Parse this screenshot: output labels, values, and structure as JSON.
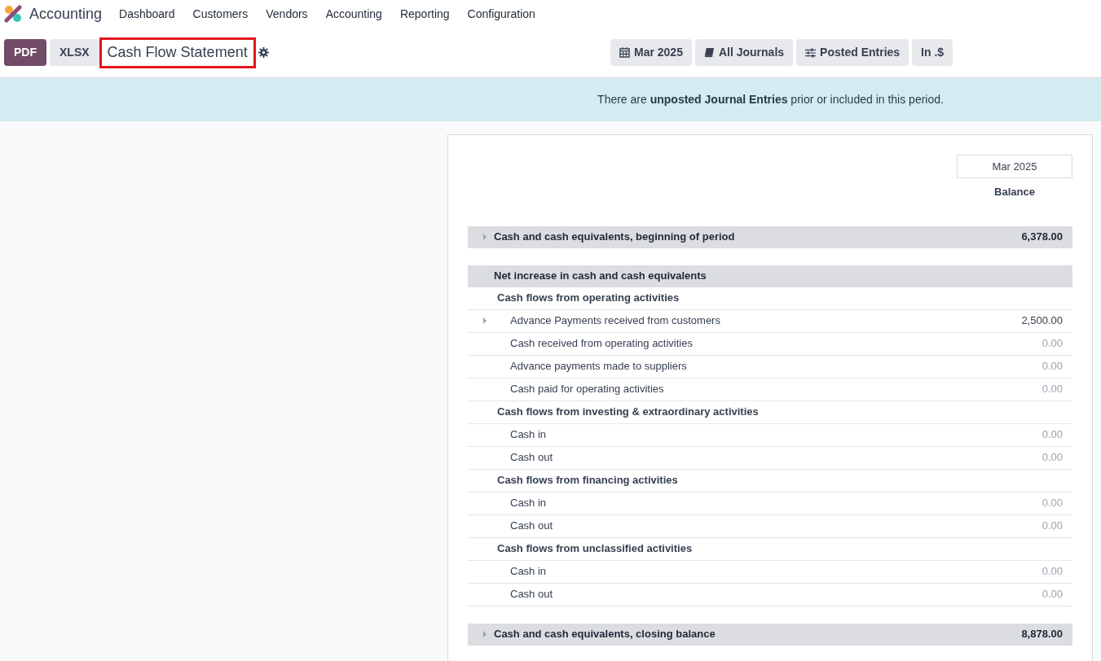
{
  "app": {
    "name": "Accounting"
  },
  "menu": [
    "Dashboard",
    "Customers",
    "Vendors",
    "Accounting",
    "Reporting",
    "Configuration"
  ],
  "export_buttons": [
    "PDF",
    "XLSX"
  ],
  "report_title": "Cash Flow Statement",
  "filters": [
    {
      "kind": "date",
      "label": "Mar 2025"
    },
    {
      "kind": "journal",
      "label": "All Journals"
    },
    {
      "kind": "options",
      "label": "Posted Entries"
    },
    {
      "kind": "currency",
      "label": "In .$"
    }
  ],
  "alert": "There are **unposted Journal Entries** prior or included in this period.",
  "column": {
    "period": "Mar 2025",
    "label": "Balance"
  },
  "opening": {
    "label": "Cash and cash equivalents, beginning of period",
    "value": "6,378.00",
    "expandable": true
  },
  "net_increase": {
    "label": "Net increase in cash and cash equivalents",
    "groups": [
      {
        "label": "Cash flows from operating activities",
        "lines": [
          {
            "label": "Advance Payments received from customers",
            "value": "2,500.00",
            "expandable": true,
            "muted": false
          },
          {
            "label": "Cash received from operating activities",
            "value": "0.00",
            "expandable": false,
            "muted": true
          },
          {
            "label": "Advance payments made to suppliers",
            "value": "0.00",
            "expandable": false,
            "muted": true
          },
          {
            "label": "Cash paid for operating activities",
            "value": "0.00",
            "expandable": false,
            "muted": true
          }
        ]
      },
      {
        "label": "Cash flows from investing & extraordinary activities",
        "lines": [
          {
            "label": "Cash in",
            "value": "0.00",
            "expandable": false,
            "muted": true
          },
          {
            "label": "Cash out",
            "value": "0.00",
            "expandable": false,
            "muted": true
          }
        ]
      },
      {
        "label": "Cash flows from financing activities",
        "lines": [
          {
            "label": "Cash in",
            "value": "0.00",
            "expandable": false,
            "muted": true
          },
          {
            "label": "Cash out",
            "value": "0.00",
            "expandable": false,
            "muted": true
          }
        ]
      },
      {
        "label": "Cash flows from unclassified activities",
        "lines": [
          {
            "label": "Cash in",
            "value": "0.00",
            "expandable": false,
            "muted": true
          },
          {
            "label": "Cash out",
            "value": "0.00",
            "expandable": false,
            "muted": true
          }
        ]
      }
    ]
  },
  "closing": {
    "label": "Cash and cash equivalents, closing balance",
    "value": "8,878.00",
    "expandable": true
  }
}
